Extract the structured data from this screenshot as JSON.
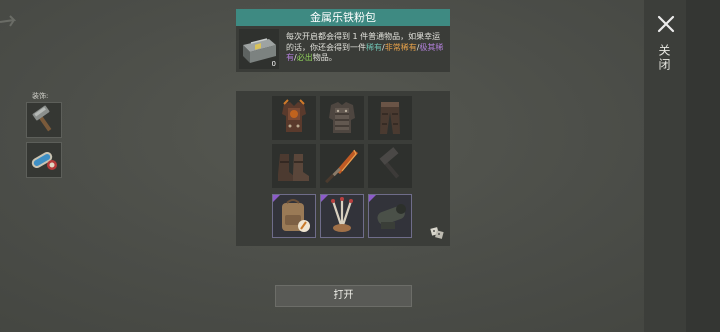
{
  "header": {
    "title": "金属乐铁粉包"
  },
  "chest": {
    "count": "0",
    "description_parts": [
      "每次开启都会得到 1 件普通物品，如果幸运的话，你还会得到一件",
      "稀有",
      "/",
      "非常稀有",
      "/",
      "极其稀有",
      "/",
      "必出",
      "物品。"
    ],
    "rarity_colors": {
      "rare": "#6fc2b2",
      "very_rare": "#e8a24a",
      "extremely_rare": "#b07fd8",
      "guaranteed": "#8ed05a"
    }
  },
  "equip": {
    "label": "装饰:"
  },
  "side": {
    "close_label": "关闭"
  },
  "actions": {
    "open_label": "打开"
  },
  "items": {
    "row1": [
      "metal-chest-armor-icon",
      "metal-vest-icon",
      "metal-pants-icon"
    ],
    "row2": [
      "metal-boots-icon",
      "flame-blade-icon",
      "hammer-icon"
    ],
    "row3": [
      "backpack-icon",
      "drumsticks-icon",
      "cannon-icon"
    ],
    "row3_rarity_color": "#8c5cc8"
  }
}
